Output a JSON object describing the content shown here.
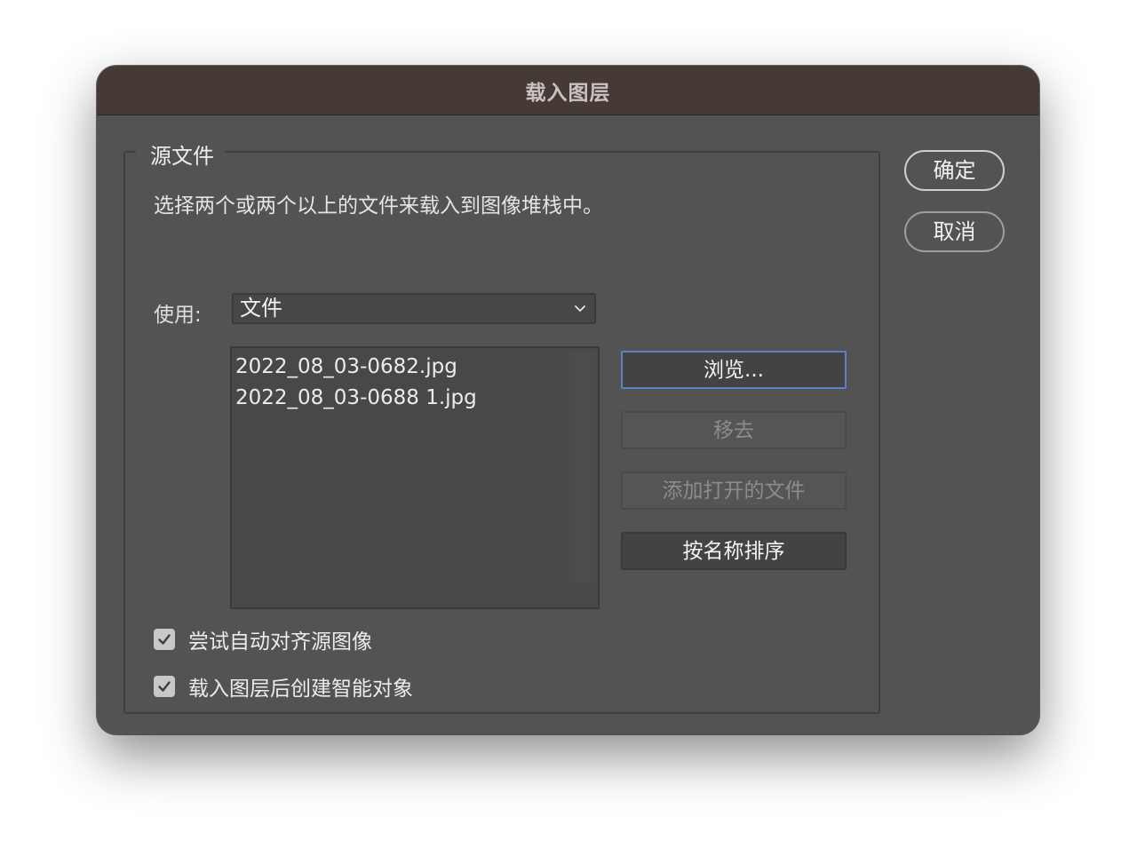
{
  "dialog": {
    "title": "载入图层"
  },
  "source_group": {
    "legend": "源文件",
    "description": "选择两个或两个以上的文件来载入到图像堆栈中。",
    "use_label": "使用:",
    "use_selected": "文件",
    "files": [
      "2022_08_03-0682.jpg",
      "2022_08_03-0688 1.jpg"
    ],
    "buttons": {
      "browse": "浏览...",
      "remove": "移去",
      "add_open": "添加打开的文件",
      "sort_by_name": "按名称排序"
    },
    "options": {
      "auto_align": {
        "label": "尝试自动对齐源图像",
        "checked": true
      },
      "smart_object": {
        "label": "载入图层后创建智能对象",
        "checked": true
      }
    }
  },
  "actions": {
    "ok": "确定",
    "cancel": "取消"
  },
  "colors": {
    "dialog_bg": "#535353",
    "titlebar_bg": "#463a37",
    "focus_border": "#5b81c7"
  }
}
